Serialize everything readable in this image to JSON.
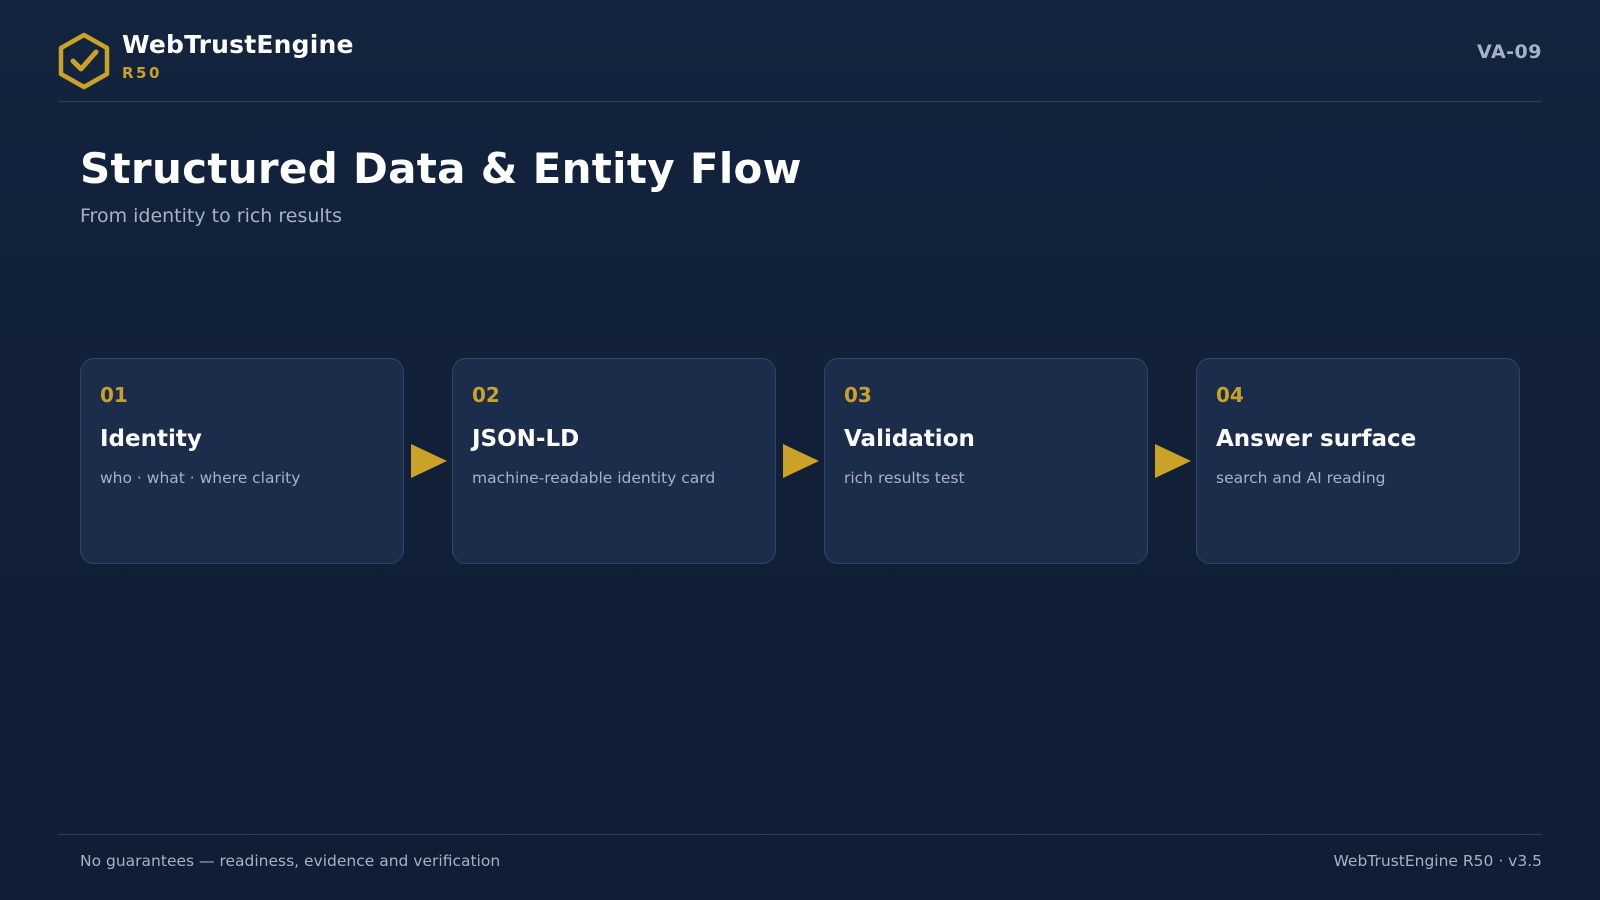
{
  "brand": {
    "name": "WebTrustEngine",
    "release": "R50",
    "logo_icon": "hexagon-check-icon",
    "accent_color": "#c9a227"
  },
  "header": {
    "doc_code": "VA-09"
  },
  "page": {
    "title": "Structured Data & Entity Flow",
    "subtitle": "From identity to rich results"
  },
  "flow": {
    "steps": [
      {
        "number": "01",
        "title": "Identity",
        "description": "who · what · where clarity"
      },
      {
        "number": "02",
        "title": "JSON-LD",
        "description": "machine-readable identity card"
      },
      {
        "number": "03",
        "title": "Validation",
        "description": "rich results test"
      },
      {
        "number": "04",
        "title": "Answer surface",
        "description": "search and AI reading"
      }
    ],
    "connector_icon": "arrow-right-icon"
  },
  "footer": {
    "disclaimer": "No guarantees — readiness, evidence and verification",
    "version": "WebTrustEngine R50 · v3.5"
  },
  "colors": {
    "background": "#12223b",
    "card_background": "#1b2d4b",
    "card_border": "#2f4568",
    "muted_text": "#a7b1c2",
    "accent": "#c9a227"
  }
}
